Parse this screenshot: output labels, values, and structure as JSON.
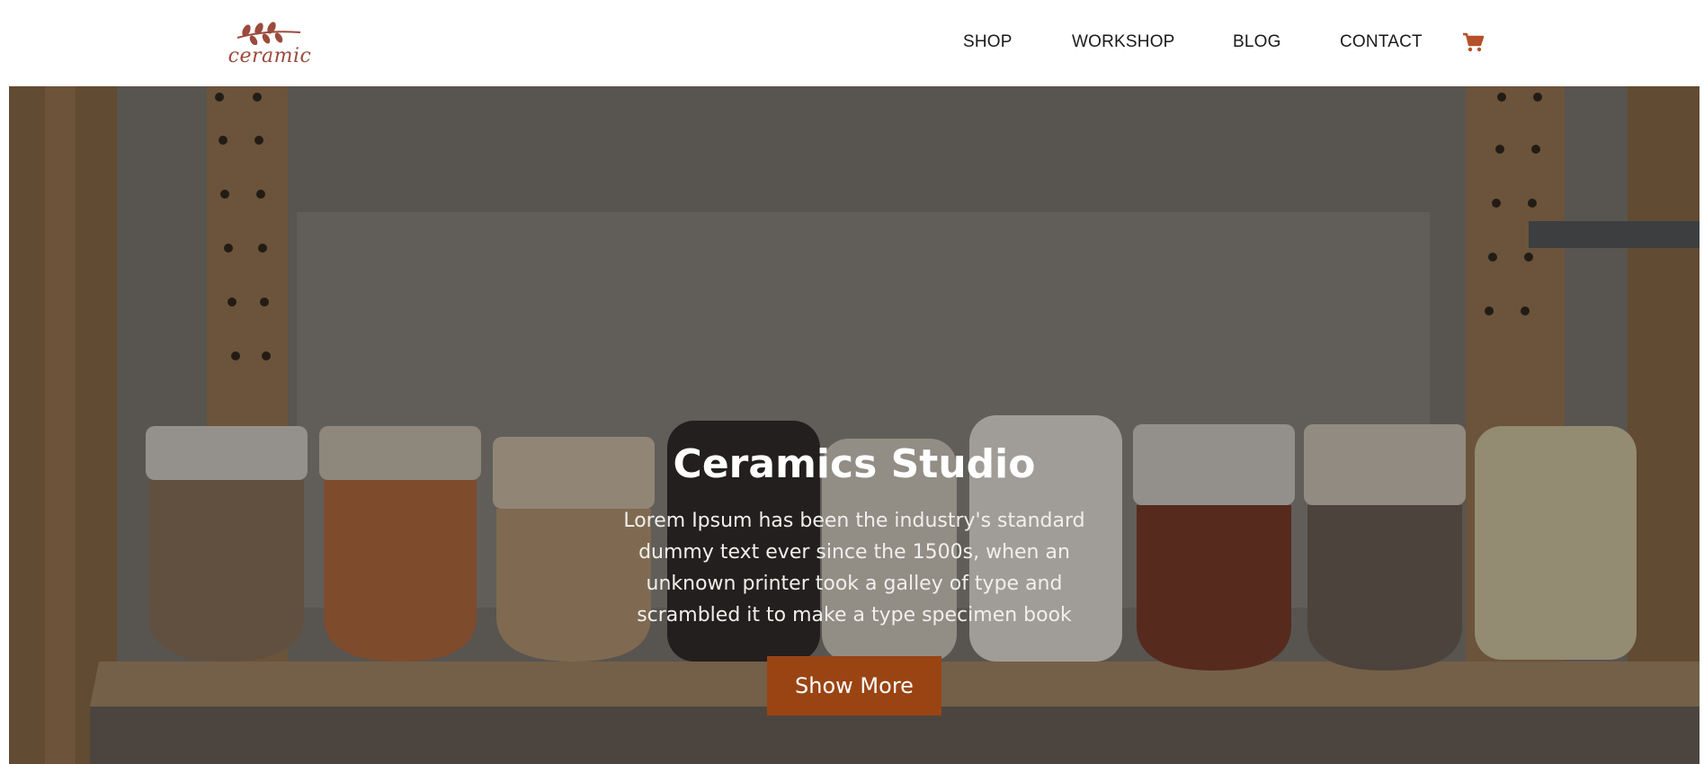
{
  "brand": {
    "logo_text": "ceramic",
    "logo_color": "#9b4a3c"
  },
  "nav": {
    "items": [
      {
        "label": "SHOP"
      },
      {
        "label": "WORKSHOP"
      },
      {
        "label": "BLOG"
      },
      {
        "label": "CONTACT"
      }
    ],
    "cart_icon": "shopping-cart-icon",
    "cart_color": "#b5502a"
  },
  "hero": {
    "title": "Ceramics Studio",
    "description": "Lorem Ipsum has been the industry's standard dummy text ever since the 1500s, when an unknown printer took a galley of type and scrambled it to make a type specimen book",
    "button_label": "Show More",
    "button_color": "#9a4413"
  }
}
